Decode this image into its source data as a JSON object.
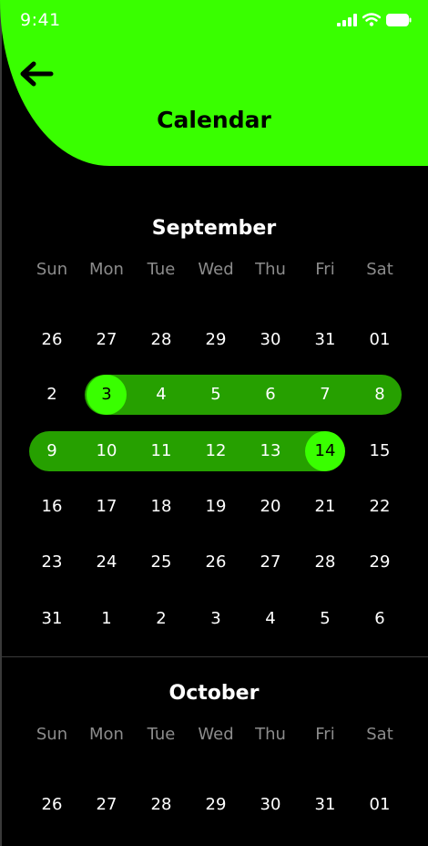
{
  "status": {
    "time": "9:41"
  },
  "header": {
    "title": "Calendar"
  },
  "colors": {
    "accent": "#39ff00",
    "range": "#26a000",
    "muted": "#8c8c8c"
  },
  "weekdays": [
    "Sun",
    "Mon",
    "Tue",
    "Wed",
    "Thu",
    "Fri",
    "Sat"
  ],
  "months": [
    {
      "name": "September",
      "weeks": [
        [
          "26",
          "27",
          "28",
          "29",
          "30",
          "31",
          "01"
        ],
        [
          "2",
          "3",
          "4",
          "5",
          "6",
          "7",
          "8"
        ],
        [
          "9",
          "10",
          "11",
          "12",
          "13",
          "14",
          "15"
        ],
        [
          "16",
          "17",
          "18",
          "19",
          "20",
          "21",
          "22"
        ],
        [
          "23",
          "24",
          "25",
          "26",
          "27",
          "28",
          "29"
        ],
        [
          "31",
          "1",
          "2",
          "3",
          "4",
          "5",
          "6"
        ]
      ]
    },
    {
      "name": "October",
      "weeks": [
        [
          "26",
          "27",
          "28",
          "29",
          "30",
          "31",
          "01"
        ]
      ]
    }
  ],
  "selection": {
    "start": "3",
    "end": "14"
  }
}
